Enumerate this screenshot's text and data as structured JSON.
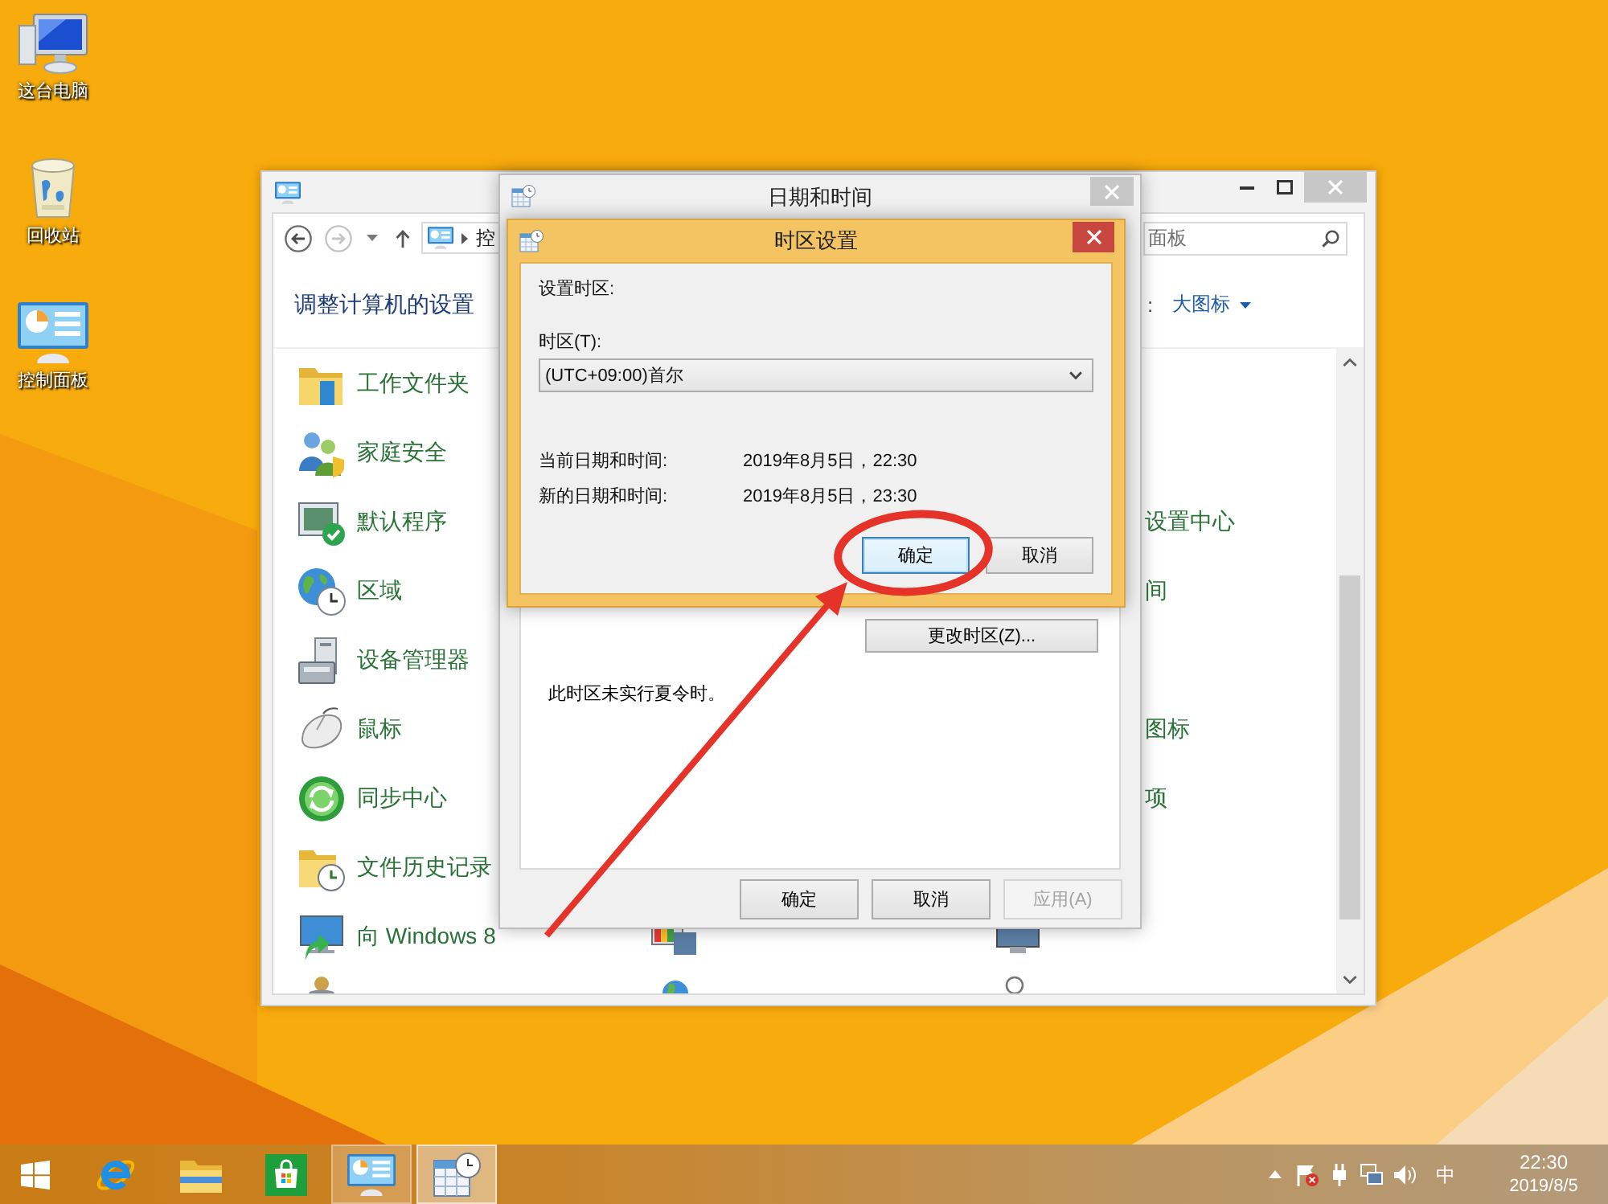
{
  "desktop_icons": [
    {
      "label": "这台电脑",
      "kind": "computer"
    },
    {
      "label": "回收站",
      "kind": "recycle-bin"
    },
    {
      "label": "控制面板",
      "kind": "control-panel"
    }
  ],
  "control_panel": {
    "address": "控",
    "search": {
      "placeholder": "面板"
    },
    "heading": "调整计算机的设置",
    "view_by": {
      "label": ":",
      "value": "大图标"
    },
    "items": [
      {
        "label": "工作文件夹",
        "kind": "work-folders"
      },
      {
        "label": "家庭安全",
        "kind": "family"
      },
      {
        "label": "默认程序",
        "kind": "default-programs"
      },
      {
        "label": "区域",
        "kind": "region"
      },
      {
        "label": "设备管理器",
        "kind": "device-manager"
      },
      {
        "label": "鼠标",
        "kind": "mouse"
      },
      {
        "label": "同步中心",
        "kind": "sync"
      },
      {
        "label": "文件历史记录",
        "kind": "file-history"
      },
      {
        "label": "向 Windows 8",
        "kind": "add-features"
      }
    ],
    "right_items": [
      {
        "label": "设置中心"
      },
      {
        "label": "间"
      },
      {
        "label": "图标"
      },
      {
        "label": "项"
      }
    ]
  },
  "date_time_dialog": {
    "title": "日期和时间",
    "change_zone_button": "更改时区(Z)...",
    "dst_note": "此时区未实行夏令时。",
    "buttons": [
      {
        "label": "确定",
        "disabled": false
      },
      {
        "label": "取消",
        "disabled": false
      },
      {
        "label": "应用(A)",
        "disabled": true
      }
    ]
  },
  "timezone_dialog": {
    "title": "时区设置",
    "heading": "设置时区:",
    "zone_label": "时区(T):",
    "zone_value": "(UTC+09:00)首尔",
    "rows": [
      {
        "label": "当前日期和时间:",
        "value": "2019年8月5日，22:30"
      },
      {
        "label": "新的日期和时间:",
        "value": "2019年8月5日，23:30"
      }
    ],
    "buttons": [
      {
        "label": "确定",
        "focused": true
      },
      {
        "label": "取消",
        "focused": false
      }
    ]
  },
  "taskbar": {
    "apps": [
      {
        "kind": "browser",
        "running": false,
        "selected": false
      },
      {
        "kind": "file-explorer",
        "running": false,
        "selected": false
      },
      {
        "kind": "store",
        "running": false,
        "selected": false
      },
      {
        "kind": "control-panel",
        "running": true,
        "selected": false
      },
      {
        "kind": "date-time",
        "running": true,
        "selected": true
      }
    ],
    "ime": "中",
    "clock": {
      "time": "22:30",
      "date": "2019/8/5"
    }
  }
}
